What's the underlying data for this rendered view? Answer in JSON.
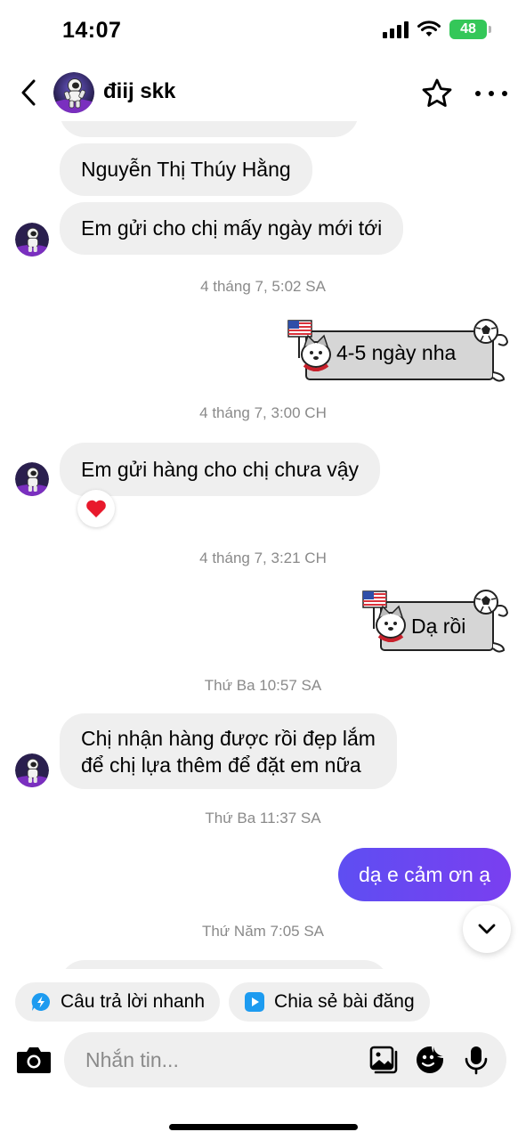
{
  "status_bar": {
    "time": "14:07",
    "battery": "48"
  },
  "header": {
    "contact_name": "điij skk"
  },
  "messages": {
    "in_1": "Nguyễn Thị Thúy Hằng",
    "in_2": "Em gửi cho chị mấy ngày mới tới",
    "ts_1": "4 tháng 7, 5:02 SA",
    "sticker_1": "4-5 ngày nha",
    "ts_2": "4 tháng 7, 3:00 CH",
    "in_3": "Em gửi hàng cho chị chưa vậy",
    "reaction_3": "❤️",
    "ts_3": "4 tháng 7, 3:21 CH",
    "sticker_2": "Dạ rồi",
    "ts_4": "Thứ Ba 10:57 SA",
    "in_4_line1": "Chị nhận hàng được rồi đẹp lắm",
    "in_4_line2": "để chị lựa thêm để đặt em nữa",
    "ts_5": "Thứ Ba 11:37 SA",
    "out_1": "dạ e cảm ơn ạ",
    "ts_6": "Thứ Năm 7:05 SA"
  },
  "quick_actions": {
    "quick_reply": "Câu trả lời nhanh",
    "share_post": "Chia sẻ bài đăng"
  },
  "composer": {
    "placeholder": "Nhắn tin..."
  },
  "colors": {
    "outgoing_bubble": "#6a46f1",
    "incoming_bubble": "#efefef",
    "timestamp": "#8a8a8a"
  }
}
